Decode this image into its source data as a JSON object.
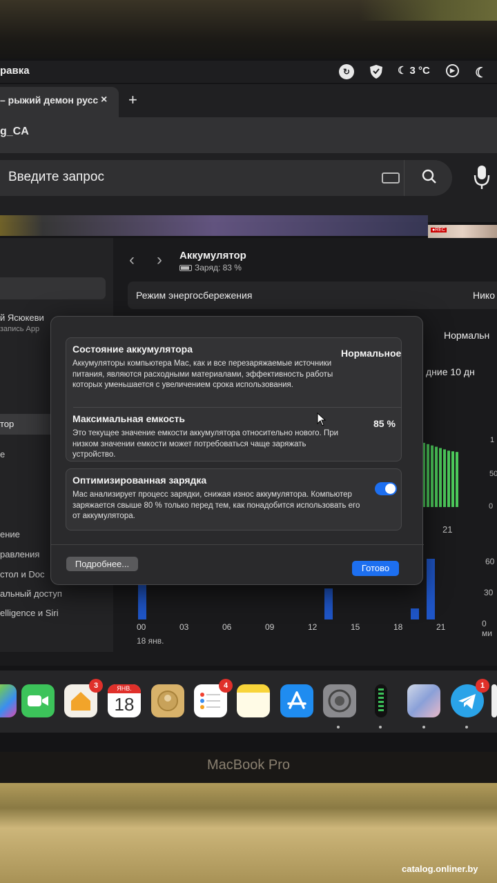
{
  "menubar": {
    "app_menu": "равка",
    "temperature": "3 °C"
  },
  "browser": {
    "tab_title": "– рыжий демон русс",
    "tab_close": "×",
    "new_tab": "+",
    "bookmark": "g_CA",
    "search_placeholder": "Введите запрос"
  },
  "settings": {
    "page_title": "Аккумулятор",
    "charge_text": "Заряд: 83 %",
    "low_power_label": "Режим энергосбережения",
    "low_power_value": "Нико",
    "health_summary": "Нормальн",
    "range_label": "дние 10 дн",
    "sidebar": {
      "user_name": "й Ясюкеви",
      "user_sub": "запись App",
      "selected_item": "тор",
      "item_e": "е",
      "item_1": "ение",
      "item_2": "равления",
      "item_3": "стол и Doc",
      "item_4": "альный доступ",
      "item_5": "elligence и Siri"
    },
    "chart_top": {
      "ticks": [
        "1",
        "50",
        "0"
      ],
      "x_label": "21"
    },
    "chart_bottom": {
      "y_ticks": [
        "60",
        "30",
        "0 ми"
      ],
      "x_ticks": [
        "00",
        "03",
        "06",
        "09",
        "12",
        "15",
        "18",
        "21"
      ],
      "date_label": "18 янв."
    }
  },
  "dialog": {
    "health_title": "Состояние аккумулятора",
    "health_value": "Нормальное",
    "health_desc": "Аккумуляторы компьютера Mac, как и все перезаряжаемые источники питания, являются расходными материалами, эффективность работы которых уменьшается с увеличением срока использования.",
    "capacity_title": "Максимальная емкость",
    "capacity_value": "85 %",
    "capacity_desc": "Это текущее значение емкости аккумулятора относительно нового. При низком значении емкости может потребоваться чаще заряжать устройство.",
    "optimized_title": "Оптимизированная зарядка",
    "optimized_on": true,
    "optimized_desc": "Mac анализирует процесс зарядки, снижая износ аккумулятора. Компьютер заряжается свыше 80 % только перед тем, как понадобится использовать его от аккумулятора.",
    "more_button": "Подробнее...",
    "done_button": "Готово"
  },
  "dock": {
    "home_badge": "3",
    "calendar_month": "ЯНВ.",
    "calendar_day": "18",
    "reminders_badge": "4",
    "telegram_badge": "1"
  },
  "laptop_label": "MacBook Pro",
  "watermark": "catalog.onliner.by",
  "colors": {
    "accent": "#1d6ff0",
    "chart_green": "#4cc85a",
    "chart_blue": "#1f56c8"
  }
}
